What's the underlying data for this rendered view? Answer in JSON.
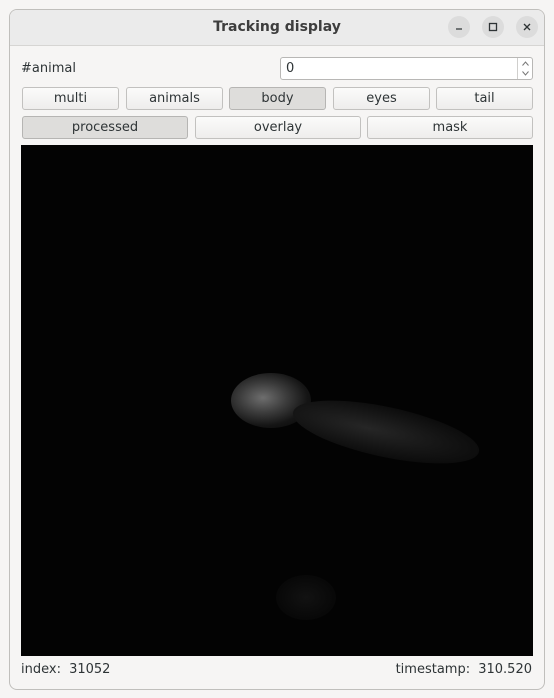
{
  "window": {
    "title": "Tracking display"
  },
  "animal_selector": {
    "label": "#animal",
    "value": "0"
  },
  "mode_buttons": [
    {
      "label": "multi",
      "active": false
    },
    {
      "label": "animals",
      "active": false
    },
    {
      "label": "body",
      "active": true
    },
    {
      "label": "eyes",
      "active": false
    },
    {
      "label": "tail",
      "active": false
    }
  ],
  "view_buttons": [
    {
      "label": "processed",
      "active": true
    },
    {
      "label": "overlay",
      "active": false
    },
    {
      "label": "mask",
      "active": false
    }
  ],
  "status": {
    "index_label": "index:",
    "index_value": "31052",
    "timestamp_label": "timestamp:",
    "timestamp_value": "310.520"
  },
  "icons": {
    "minimize": "minimize-icon",
    "maximize": "maximize-icon",
    "close": "close-icon"
  }
}
